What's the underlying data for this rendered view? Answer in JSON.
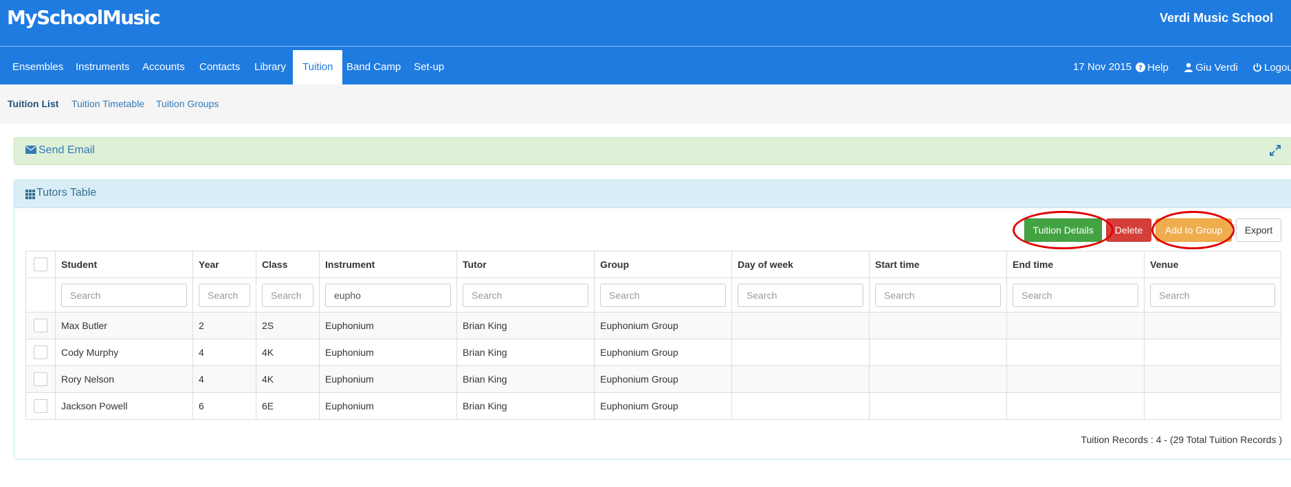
{
  "app": {
    "logo": "MySchoolMusic",
    "school_name": "Verdi Music School"
  },
  "nav": {
    "items": [
      "Ensembles",
      "Instruments",
      "Accounts",
      "Contacts",
      "Library",
      "Tuition",
      "Band Camp",
      "Set-up"
    ],
    "active": "Tuition",
    "date": "17 Nov 2015",
    "help": "Help",
    "user": "Giu Verdi",
    "logout": "Logout"
  },
  "subnav": {
    "items": [
      "Tuition List",
      "Tuition Timetable",
      "Tuition Groups"
    ],
    "active": "Tuition List"
  },
  "email_panel": {
    "title": "Send Email"
  },
  "tutors_panel": {
    "title": "Tutors Table",
    "buttons": {
      "tuition_details": "Tuition Details",
      "delete": "Delete",
      "add_to_group": "Add to Group",
      "export": "Export"
    },
    "columns": [
      "Student",
      "Year",
      "Class",
      "Instrument",
      "Tutor",
      "Group",
      "Day of week",
      "Start time",
      "End time",
      "Venue"
    ],
    "search_placeholder": "Search",
    "filters": {
      "instrument": "eupho"
    },
    "rows": [
      [
        "Max Butler",
        "2",
        "2S",
        "Euphonium",
        "Brian King",
        "Euphonium Group",
        "",
        "",
        "",
        ""
      ],
      [
        "Cody Murphy",
        "4",
        "4K",
        "Euphonium",
        "Brian King",
        "Euphonium Group",
        "",
        "",
        "",
        ""
      ],
      [
        "Rory Nelson",
        "4",
        "4K",
        "Euphonium",
        "Brian King",
        "Euphonium Group",
        "",
        "",
        "",
        ""
      ],
      [
        "Jackson Powell",
        "6",
        "6E",
        "Euphonium",
        "Brian King",
        "Euphonium Group",
        "",
        "",
        "",
        ""
      ]
    ],
    "records_text": "Tuition Records : 4 - (29 Total Tuition Records )"
  },
  "colors": {
    "primary": "#1f7be0",
    "success": "#43a343",
    "danger": "#d43f3a",
    "warning": "#f0ad4e",
    "highlight": "#e00000"
  }
}
